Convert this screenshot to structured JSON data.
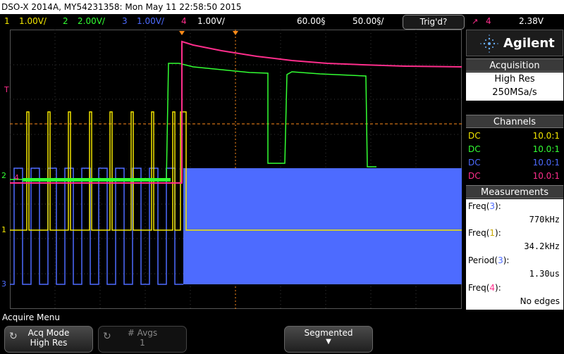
{
  "title_bar": "DSO-X 2014A, MY54231358: Mon May 11 22:58:50 2015",
  "channels": [
    {
      "num": "1",
      "scale": "1.00V/",
      "color": "#f2e600"
    },
    {
      "num": "2",
      "scale": "2.00V/",
      "color": "#33ff33"
    },
    {
      "num": "3",
      "scale": "1.00V/",
      "color": "#4d6bff"
    },
    {
      "num": "4",
      "scale": "1.00V/",
      "color": "#ff2e8c"
    }
  ],
  "timebase": {
    "delay": "60.00§",
    "scale": "50.00§/"
  },
  "trigger": {
    "status": "Trig'd?",
    "source": "4",
    "level": "2.38V"
  },
  "brand": "Agilent",
  "acquisition": {
    "header": "Acquisition",
    "mode": "High Res",
    "rate": "250MSa/s"
  },
  "channels_panel": {
    "header": "Channels",
    "rows": [
      {
        "coupling": "DC",
        "probe": "10.0:1",
        "color": "#f2e600"
      },
      {
        "coupling": "DC",
        "probe": "10.0:1",
        "color": "#33ff33"
      },
      {
        "coupling": "DC",
        "probe": "10.0:1",
        "color": "#4d6bff"
      },
      {
        "coupling": "DC",
        "probe": "10.0:1",
        "color": "#ff2e8c"
      }
    ]
  },
  "measurements": {
    "header": "Measurements",
    "items": [
      {
        "label": "Freq",
        "src": "3",
        "value": "770kHz"
      },
      {
        "label": "Freq",
        "src": "1",
        "value": "34.2kHz"
      },
      {
        "label": "Period",
        "src": "3",
        "value": "1.30us"
      },
      {
        "label": "Freq",
        "src": "4",
        "value": "No edges"
      }
    ]
  },
  "markers": {
    "trigger": "T",
    "ch2": "2",
    "ch4": "4",
    "ch1": "1",
    "ch3": "3"
  },
  "menu": {
    "title": "Acquire Menu",
    "acq_mode_label": "Acq Mode",
    "acq_mode_value": "High Res",
    "avgs_label": "# Avgs",
    "avgs_value": "1",
    "segmented_label": "Segmented"
  }
}
